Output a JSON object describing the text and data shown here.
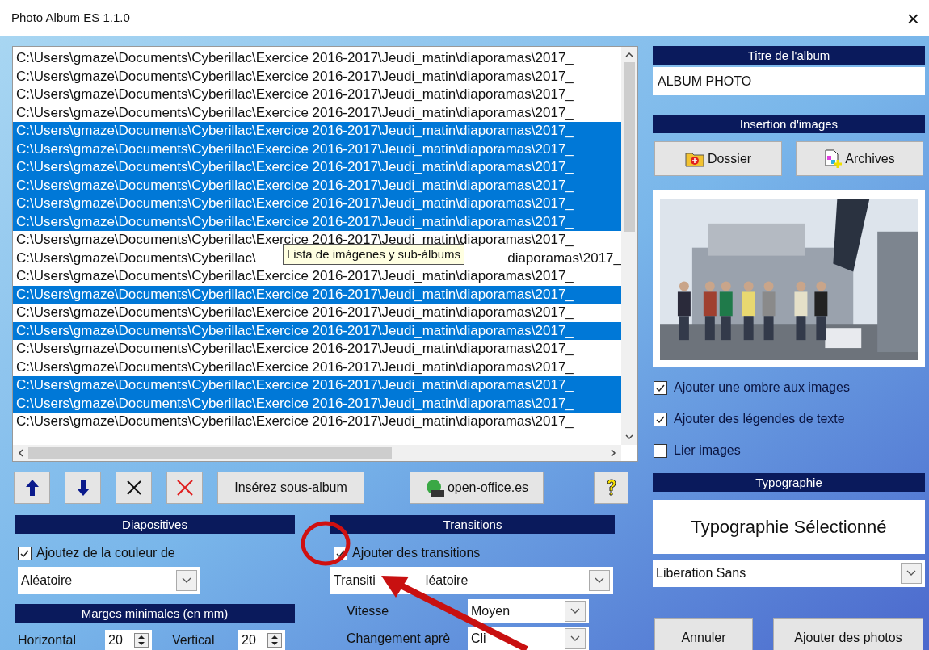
{
  "window": {
    "title": "Photo Album ES 1.1.0",
    "close": "×"
  },
  "file_list": {
    "rows": [
      {
        "text": "C:\\Users\\gmaze\\Documents\\Cyberillac\\Exercice 2016-2017\\Jeudi_matin\\diaporamas\\2017_",
        "selected": false
      },
      {
        "text": "C:\\Users\\gmaze\\Documents\\Cyberillac\\Exercice 2016-2017\\Jeudi_matin\\diaporamas\\2017_",
        "selected": false
      },
      {
        "text": "C:\\Users\\gmaze\\Documents\\Cyberillac\\Exercice 2016-2017\\Jeudi_matin\\diaporamas\\2017_",
        "selected": false
      },
      {
        "text": "C:\\Users\\gmaze\\Documents\\Cyberillac\\Exercice 2016-2017\\Jeudi_matin\\diaporamas\\2017_",
        "selected": false
      },
      {
        "text": "C:\\Users\\gmaze\\Documents\\Cyberillac\\Exercice 2016-2017\\Jeudi_matin\\diaporamas\\2017_",
        "selected": true
      },
      {
        "text": "C:\\Users\\gmaze\\Documents\\Cyberillac\\Exercice 2016-2017\\Jeudi_matin\\diaporamas\\2017_",
        "selected": true
      },
      {
        "text": "C:\\Users\\gmaze\\Documents\\Cyberillac\\Exercice 2016-2017\\Jeudi_matin\\diaporamas\\2017_",
        "selected": true
      },
      {
        "text": "C:\\Users\\gmaze\\Documents\\Cyberillac\\Exercice 2016-2017\\Jeudi_matin\\diaporamas\\2017_",
        "selected": true
      },
      {
        "text": "C:\\Users\\gmaze\\Documents\\Cyberillac\\Exercice 2016-2017\\Jeudi_matin\\diaporamas\\2017_",
        "selected": true
      },
      {
        "text": "C:\\Users\\gmaze\\Documents\\Cyberillac\\Exercice 2016-2017\\Jeudi_matin\\diaporamas\\2017_",
        "selected": true
      },
      {
        "text": "C:\\Users\\gmaze\\Documents\\Cyberillac\\Exercice 2016-2017\\Jeudi_matin\\diaporamas\\2017_",
        "selected": false
      },
      {
        "text": "C:\\Users\\gmaze\\Documents\\Cyberillac\\",
        "tail": "diaporamas\\2017_",
        "selected": false
      },
      {
        "text": "C:\\Users\\gmaze\\Documents\\Cyberillac\\Exercice 2016-2017\\Jeudi_matin\\diaporamas\\2017_",
        "selected": false
      },
      {
        "text": "C:\\Users\\gmaze\\Documents\\Cyberillac\\Exercice 2016-2017\\Jeudi_matin\\diaporamas\\2017_",
        "selected": true
      },
      {
        "text": "C:\\Users\\gmaze\\Documents\\Cyberillac\\Exercice 2016-2017\\Jeudi_matin\\diaporamas\\2017_",
        "selected": false
      },
      {
        "text": "C:\\Users\\gmaze\\Documents\\Cyberillac\\Exercice 2016-2017\\Jeudi_matin\\diaporamas\\2017_",
        "selected": true
      },
      {
        "text": "C:\\Users\\gmaze\\Documents\\Cyberillac\\Exercice 2016-2017\\Jeudi_matin\\diaporamas\\2017_",
        "selected": false
      },
      {
        "text": "C:\\Users\\gmaze\\Documents\\Cyberillac\\Exercice 2016-2017\\Jeudi_matin\\diaporamas\\2017_",
        "selected": false
      },
      {
        "text": "C:\\Users\\gmaze\\Documents\\Cyberillac\\Exercice 2016-2017\\Jeudi_matin\\diaporamas\\2017_",
        "selected": true
      },
      {
        "text": "C:\\Users\\gmaze\\Documents\\Cyberillac\\Exercice 2016-2017\\Jeudi_matin\\diaporamas\\2017_",
        "selected": true
      },
      {
        "text": "C:\\Users\\gmaze\\Documents\\Cyberillac\\Exercice 2016-2017\\Jeudi_matin\\diaporamas\\2017_",
        "selected": false
      }
    ],
    "tooltip": "Lista de imágenes y sub-álbums"
  },
  "toolbar": [
    {
      "kind": "up"
    },
    {
      "kind": "down"
    },
    {
      "kind": "remove"
    },
    {
      "kind": "delete"
    },
    {
      "kind": "text",
      "label": "Insérez sous-album"
    },
    {
      "kind": "link",
      "label": "open-office.es"
    },
    {
      "kind": "help"
    }
  ],
  "diapositives": {
    "title": "Diapositives",
    "color_check": {
      "label": "Ajoutez de la couleur de",
      "checked": true
    },
    "color_select": "Aléatoire",
    "margins_title": "Marges minimales (en mm)",
    "horizontal": {
      "label": "Horizontal",
      "value": "20"
    },
    "vertical": {
      "label": "Vertical",
      "value": "20"
    }
  },
  "transitions": {
    "title": "Transitions",
    "check": {
      "label": "Ajouter des transitions",
      "checked": true
    },
    "select": {
      "start": "Transiti",
      "end": "léatoire"
    },
    "speed": {
      "label": "Vitesse",
      "value": "Moyen"
    },
    "change": {
      "label": "Changement aprè",
      "value": "Cli"
    }
  },
  "album_title": {
    "title": "Titre de l'album",
    "value": "ALBUM PHOTO"
  },
  "insertion": {
    "title": "Insertion d'images",
    "buttons": [
      "Dossier",
      "Archives"
    ],
    "preview": {
      "kind": "picture"
    }
  },
  "options": [
    {
      "label": "Ajouter une ombre aux images",
      "checked": true
    },
    {
      "label": "Ajouter des légendes de texte",
      "checked": true
    },
    {
      "label": "Lier images",
      "checked": false
    }
  ],
  "typography": {
    "title": "Typographie",
    "preview": "Typographie Sélectionné",
    "font": "Liberation Sans"
  },
  "buttons": [
    "Annuler",
    "Ajouter des photos"
  ]
}
